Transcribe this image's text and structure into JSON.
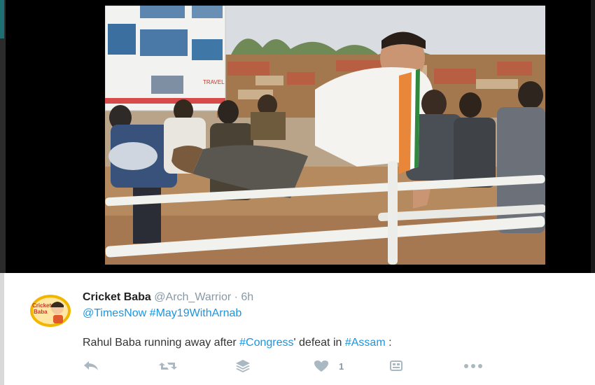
{
  "media": {
    "description_icon": "photo-image",
    "poster_text": "TRAVEL"
  },
  "tweet": {
    "display_name": "Cricket Baba",
    "handle": "@Arch_Warrior",
    "separator": "·",
    "time": "6h",
    "mentions": [
      "@TimesNow",
      "#May19WithArnab"
    ],
    "text_before": "Rahul Baba running away after ",
    "hashtag_congress": "#Congress",
    "text_middle": "' defeat in ",
    "hashtag_assam": "#Assam",
    "text_after": " :",
    "avatar_text_line1": "Cricket",
    "avatar_text_line2": "Baba",
    "like_count": "1"
  },
  "actions": {
    "icons": [
      "reply-icon",
      "retweet-icon",
      "layers-icon",
      "heart-icon",
      "image-icon",
      "more-icon"
    ]
  },
  "colors": {
    "link": "#1b95e0",
    "muted": "#8899a6",
    "action_icon": "#aab8c2"
  }
}
